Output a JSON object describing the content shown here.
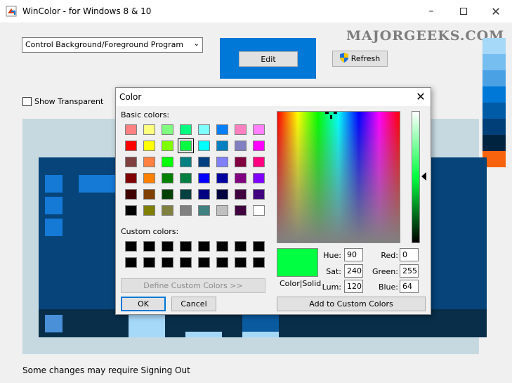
{
  "window": {
    "title": "WinColor - for Windows 8 & 10",
    "minimize_icon": "minimize-icon",
    "maximize_icon": "maximize-icon",
    "close_icon": "close-icon"
  },
  "main": {
    "program_select_value": "Control Background/Foreground Program",
    "edit_label": "Edit",
    "refresh_label": "Refresh",
    "watermark": "MAJORGEEKS.COM",
    "show_transparent_label": "Show Transparent",
    "footer_note": "Some changes may require Signing Out"
  },
  "palette_swatches": [
    "#a6d8f8",
    "#76bdf0",
    "#4aa1e4",
    "#0078d7",
    "#005ba6",
    "#003f77",
    "#002340",
    "#f7630c"
  ],
  "dialog": {
    "title": "Color",
    "basic_colors_label": "Basic colors:",
    "custom_colors_label": "Custom colors:",
    "define_custom_label": "Define Custom Colors >>",
    "ok_label": "OK",
    "cancel_label": "Cancel",
    "color_solid_label": "Color|Solid",
    "add_custom_label": "Add to Custom Colors",
    "hue_label": "Hue:",
    "sat_label": "Sat:",
    "lum_label": "Lum:",
    "red_label": "Red:",
    "green_label": "Green:",
    "blue_label": "Blue:",
    "hue": "90",
    "sat": "240",
    "lum": "120",
    "red": "0",
    "green": "255",
    "blue": "64",
    "selected_color": "#00ff40",
    "basic_colors": [
      "#ff8080",
      "#ffff80",
      "#80ff80",
      "#00ff80",
      "#80ffff",
      "#0080ff",
      "#ff80c0",
      "#ff80ff",
      "#ff0000",
      "#ffff00",
      "#80ff00",
      "#00ff40",
      "#00ffff",
      "#0080c0",
      "#8080c0",
      "#ff00ff",
      "#804040",
      "#ff8040",
      "#00ff00",
      "#008080",
      "#004080",
      "#8080ff",
      "#800040",
      "#ff0080",
      "#800000",
      "#ff8000",
      "#008000",
      "#008040",
      "#0000ff",
      "#0000a0",
      "#800080",
      "#8000ff",
      "#400000",
      "#804000",
      "#004000",
      "#004040",
      "#000080",
      "#000040",
      "#400040",
      "#400080",
      "#000000",
      "#808000",
      "#808040",
      "#808080",
      "#408080",
      "#c0c0c0",
      "#400040",
      "#ffffff"
    ],
    "selected_index": 11,
    "custom_colors": [
      "#000000",
      "#000000",
      "#000000",
      "#000000",
      "#000000",
      "#000000",
      "#000000",
      "#000000",
      "#000000",
      "#000000",
      "#000000",
      "#000000",
      "#000000",
      "#000000",
      "#000000",
      "#000000"
    ]
  }
}
